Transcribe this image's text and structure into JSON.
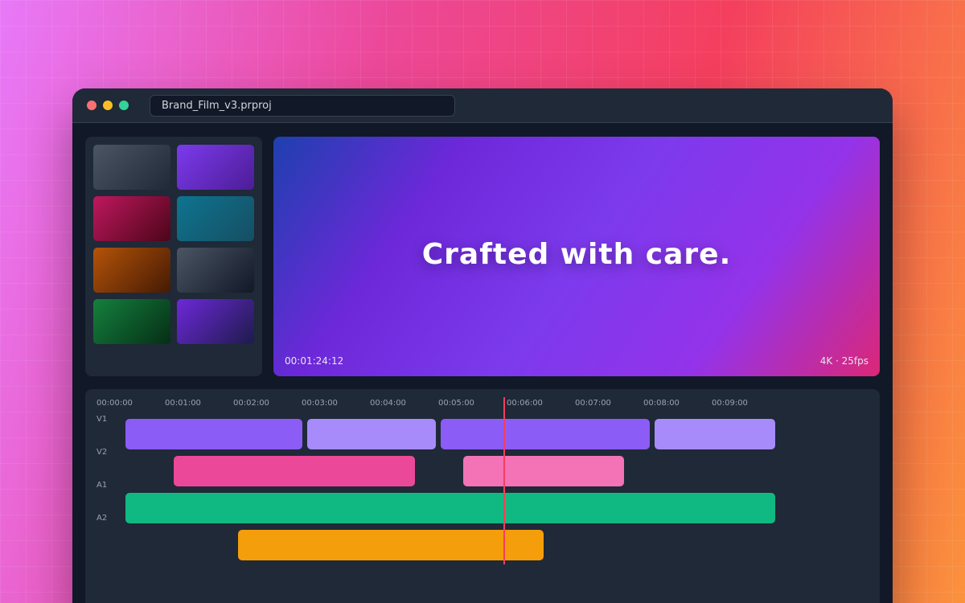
{
  "window": {
    "file_name": "Brand_Film_v3.prproj"
  },
  "media_bin": {
    "thumbnails": [
      {
        "name": "clip-thumb-1",
        "colors": [
          "#4b5563",
          "#1f2937"
        ]
      },
      {
        "name": "clip-thumb-2",
        "colors": [
          "#7c3aed",
          "#4c1d95"
        ]
      },
      {
        "name": "clip-thumb-3",
        "colors": [
          "#be185d",
          "#4c0519"
        ]
      },
      {
        "name": "clip-thumb-4",
        "colors": [
          "#0e7490",
          "#164e63"
        ]
      },
      {
        "name": "clip-thumb-5",
        "colors": [
          "#b45309",
          "#451a03"
        ]
      },
      {
        "name": "clip-thumb-6",
        "colors": [
          "#4b5563",
          "#111827"
        ]
      },
      {
        "name": "clip-thumb-7",
        "colors": [
          "#15803d",
          "#052e16"
        ]
      },
      {
        "name": "clip-thumb-8",
        "colors": [
          "#6d28d9",
          "#1e1b4b"
        ]
      }
    ]
  },
  "preview": {
    "title": "Crafted with care.",
    "timecode": "00:01:24:12",
    "format": "4K · 25fps"
  },
  "timeline": {
    "ruler": [
      "00:00:00",
      "00:01:00",
      "00:02:00",
      "00:03:00",
      "00:04:00",
      "00:05:00",
      "00:06:00",
      "00:07:00",
      "00:08:00",
      "00:09:00"
    ],
    "tracks": [
      "V1",
      "V2",
      "A1",
      "A2"
    ],
    "clip_colors": {
      "violet": "#8b5cf6",
      "lavender": "#a78bfa",
      "pink": "#ec4899",
      "light_pink": "#f472b6",
      "green": "#10b981",
      "amber": "#f59e0b"
    },
    "playhead_color": "#f43f5e"
  }
}
